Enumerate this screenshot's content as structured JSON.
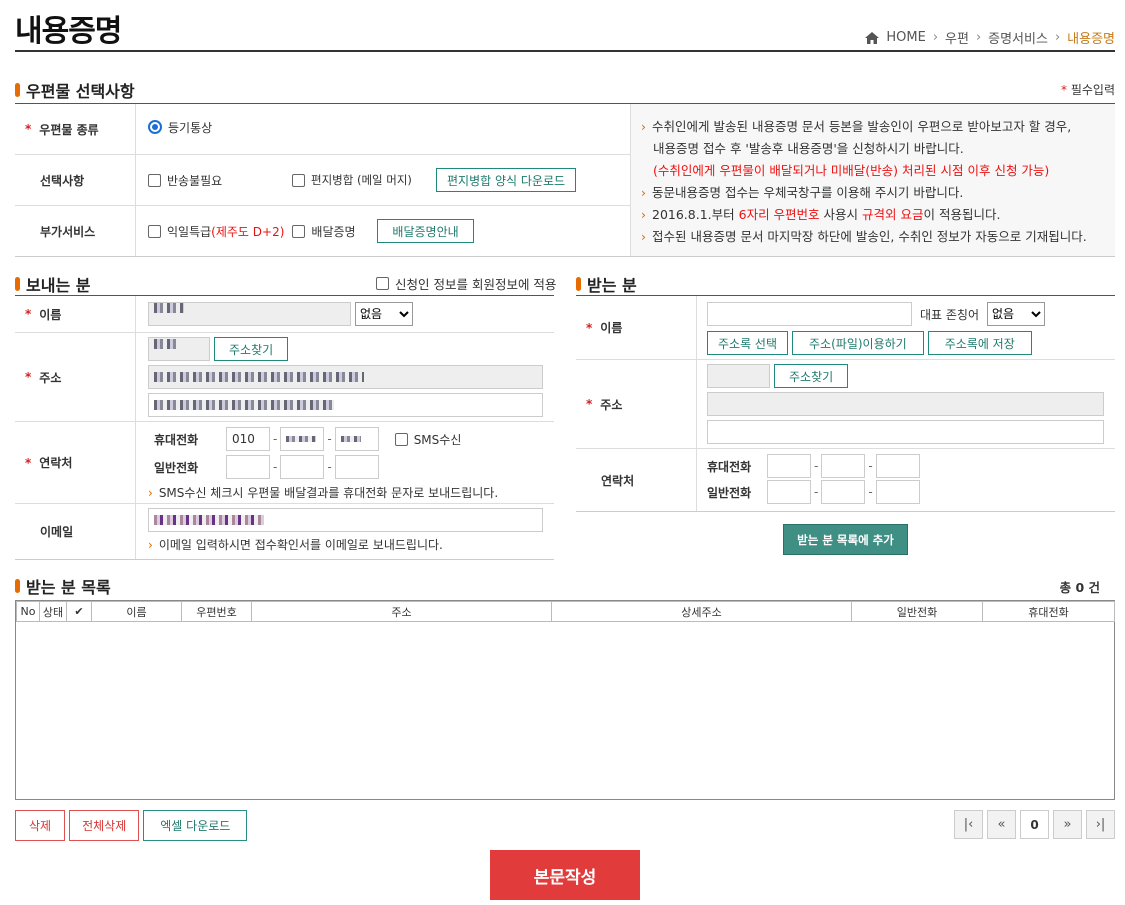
{
  "header": {
    "title": "내용증명",
    "breadcrumb": [
      "HOME",
      "우편",
      "증명서비스",
      "내용증명"
    ]
  },
  "mail_options": {
    "title": "우편물 선택사항",
    "required_note": "필수입력",
    "type_label": "우편물 종류",
    "type_value": "등기통상",
    "options_label": "선택사항",
    "opt_no_return": "반송불필요",
    "opt_merge": "편지병합 (메일 머지)",
    "merge_download": "편지병합 양식 다운로드",
    "extra_label": "부가서비스",
    "opt_nextday": "익일특급",
    "opt_nextday_note": "(제주도 D+2)",
    "opt_delivery_proof": "배달증명",
    "delivery_guide": "배달증명안내",
    "info_1a": "수취인에게 발송된 내용증명 문서 등본을 발송인이 우편으로 받아보고자 할 경우,",
    "info_1b": "내용증명 접수 후 '발송후 내용증명'을 신청하시기 바랍니다.",
    "info_1c": "(수취인에게 우편물이 배달되거나 미배달(반송) 처리된 시점 이후 신청 가능)",
    "info_2": "동문내용증명 접수는 우체국창구를 이용해 주시기 바랍니다.",
    "info_3a": "2016.8.1.부터",
    "info_3b": "6자리 우편번호",
    "info_3c": "사용시",
    "info_3d": "규격외 요금",
    "info_3e": "이 적용됩니다.",
    "info_4": "접수된 내용증명 문서 마지막장 하단에 발송인, 수취인 정보가 자동으로 기재됩니다."
  },
  "sender": {
    "title": "보내는 분",
    "apply_member": "신청인 정보를 회원정보에 적용",
    "name_label": "이름",
    "honorific": "없음",
    "address_label": "주소",
    "find_address": "주소찾기",
    "contact_label": "연락처",
    "mobile_label": "휴대전화",
    "mobile_prefix": "010",
    "phone_label": "일반전화",
    "sms": "SMS수신",
    "sms_note": "SMS수신 체크시 우편물 배달결과를 휴대전화 문자로 보내드립니다.",
    "email_label": "이메일",
    "email_note": "이메일 입력하시면 접수확인서를 이메일로 보내드립니다."
  },
  "receiver": {
    "title": "받는 분",
    "name_label": "이름",
    "rep_honorific_label": "대표 존칭어",
    "honorific": "없음",
    "btn_address_book": "주소록 선택",
    "btn_file": "주소(파일)이용하기",
    "btn_save": "주소록에 저장",
    "address_label": "주소",
    "find_address": "주소찾기",
    "contact_label": "연락처",
    "mobile_label": "휴대전화",
    "phone_label": "일반전화",
    "add_button": "받는 분 목록에 추가"
  },
  "list": {
    "title": "받는 분 목록",
    "total": "총 0 건",
    "columns": [
      "No",
      "상태",
      "✔",
      "이름",
      "우편번호",
      "주소",
      "상세주소",
      "일반전화",
      "휴대전화"
    ],
    "page": "0",
    "btn_delete": "삭제",
    "btn_delete_all": "전체삭제",
    "btn_excel": "엑셀 다운로드"
  },
  "submit": "본문작성"
}
